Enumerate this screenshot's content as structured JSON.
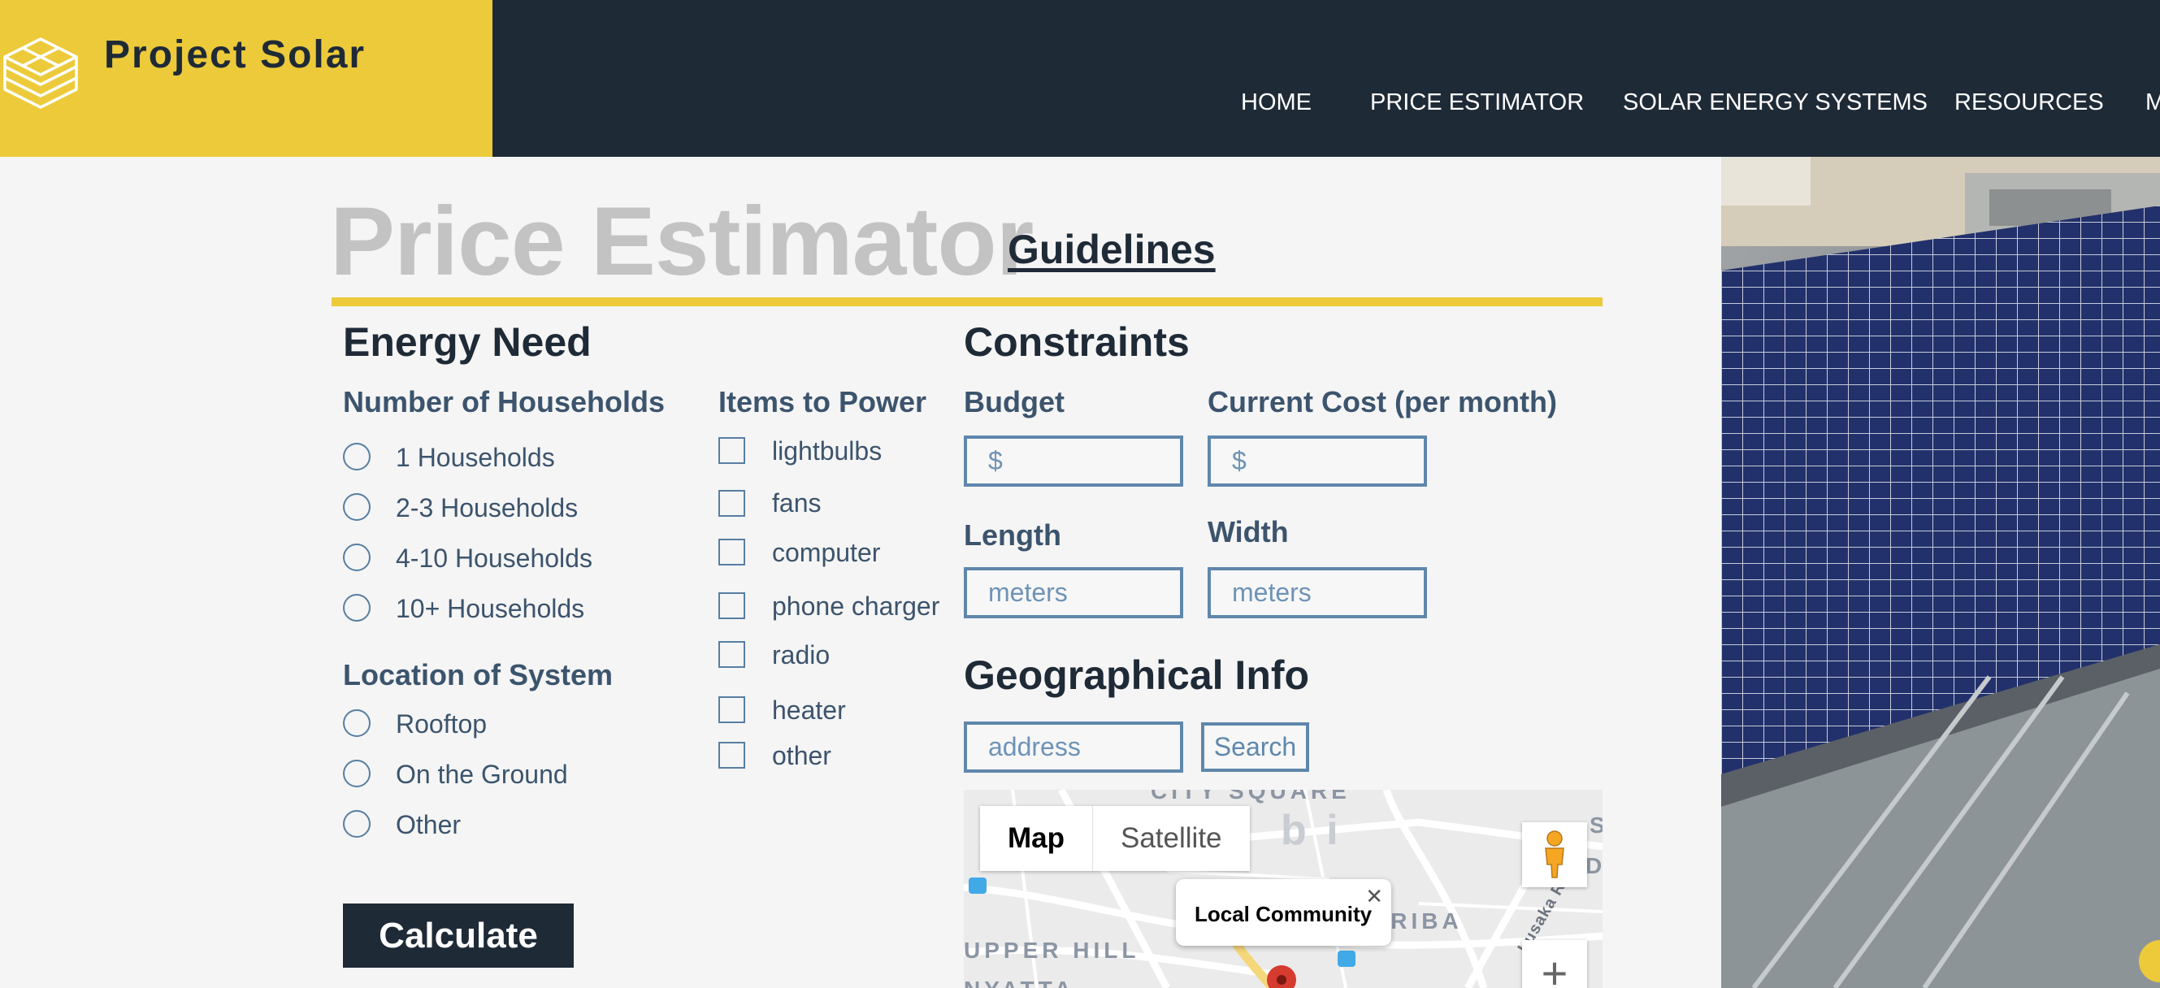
{
  "colors": {
    "header_bg": "#1f2a37",
    "brand_yellow": "#ecca3a",
    "field_border": "#5f87ac",
    "title_gray": "#c3c3c3",
    "label_slate": "#3c546d"
  },
  "header": {
    "logo_icon": "stacked-cubes-icon",
    "brand_name": "Project Solar",
    "nav": [
      {
        "label": "HOME"
      },
      {
        "label": "PRICE ESTIMATOR"
      },
      {
        "label": "SOLAR ENERGY SYSTEMS"
      },
      {
        "label": "RESOURCES"
      },
      {
        "label": "M"
      }
    ]
  },
  "page": {
    "title": "Price Estimator",
    "guidelines_link": "Guidelines"
  },
  "energy_need": {
    "heading": "Energy Need",
    "households": {
      "label": "Number of Households",
      "options": [
        "1 Households",
        "2-3 Households",
        "4-10 Households",
        "10+ Households"
      ]
    },
    "location": {
      "label": "Location of System",
      "options": [
        "Rooftop",
        "On the Ground",
        "Other"
      ]
    },
    "items": {
      "label": "Items to Power",
      "options": [
        "lightbulbs",
        "fans",
        "computer",
        "phone charger",
        "radio",
        "heater",
        "other"
      ]
    }
  },
  "constraints": {
    "heading": "Constraints",
    "budget": {
      "label": "Budget",
      "placeholder": "$"
    },
    "current_cost": {
      "label": "Current Cost (per month)",
      "placeholder": "$"
    },
    "length": {
      "label": "Length",
      "placeholder": "meters"
    },
    "width": {
      "label": "Width",
      "placeholder": "meters"
    }
  },
  "geo": {
    "heading": "Geographical Info",
    "address_placeholder": "address",
    "search_label": "Search"
  },
  "map": {
    "map_button": "Map",
    "satellite_button": "Satellite",
    "infowindow_title": "Local Community",
    "labels": {
      "city_square": "CITY SQUARE",
      "upper_hill": "UPPER HILL",
      "kariba": "ARIBA",
      "lusaka_rd": "Lusaka Rd",
      "partial_bi": "b i",
      "partial_s": "S",
      "partial_di": "DI",
      "partial_bottom": "NYATTA"
    }
  },
  "actions": {
    "calculate": "Calculate"
  }
}
